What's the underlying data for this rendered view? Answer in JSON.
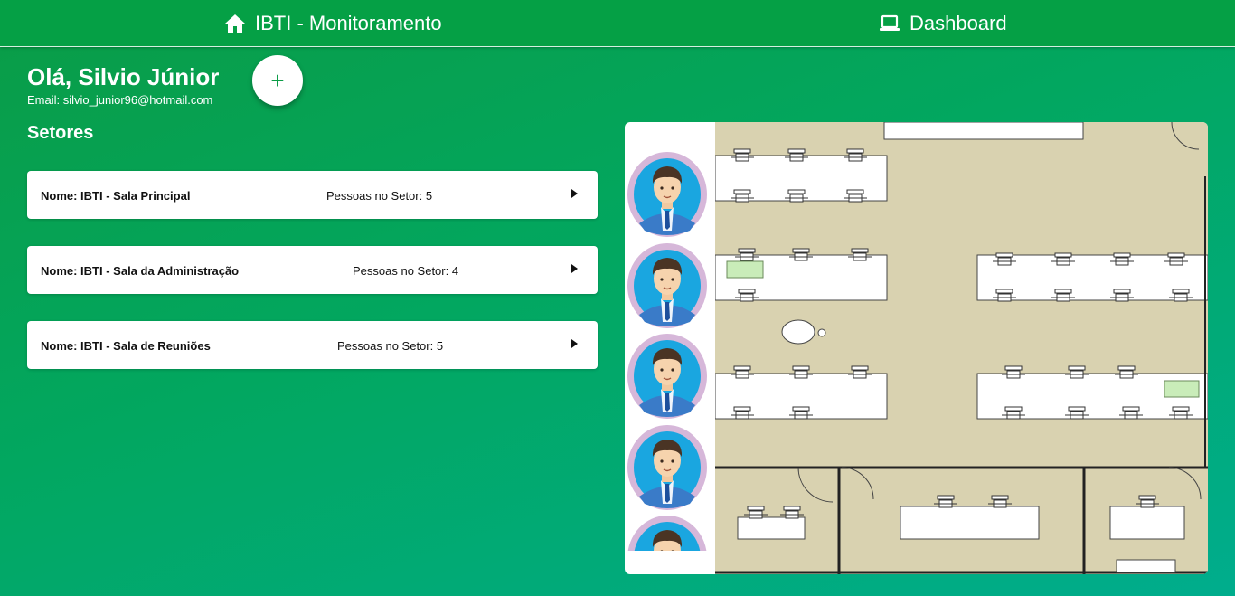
{
  "nav": {
    "home_label": "IBTI - Monitoramento",
    "dashboard_label": "Dashboard"
  },
  "user": {
    "greeting": "Olá, Silvio Júnior",
    "email": "Email: silvio_junior96@hotmail.com"
  },
  "add_button_label": "+",
  "sectors": {
    "title": "Setores",
    "items": [
      {
        "name": "Nome: IBTI - Sala Principal",
        "count": "Pessoas no Setor: 5"
      },
      {
        "name": "Nome: IBTI - Sala da Administração",
        "count": "Pessoas no Setor: 4"
      },
      {
        "name": "Nome: IBTI - Sala de Reuniões",
        "count": "Pessoas no Setor: 5"
      }
    ]
  },
  "icons": {
    "home": "home-icon",
    "dashboard": "laptop-icon",
    "arrow": "caret-right-icon",
    "avatar": "person-avatar-icon"
  },
  "colors": {
    "background_start": "#0a9c46",
    "background_end": "#00ad8d",
    "topbar": "#05a045",
    "floor": "#d9d2b0",
    "avatar_ring": "#d6b7d9",
    "avatar_inner": "#1aa6e0"
  }
}
